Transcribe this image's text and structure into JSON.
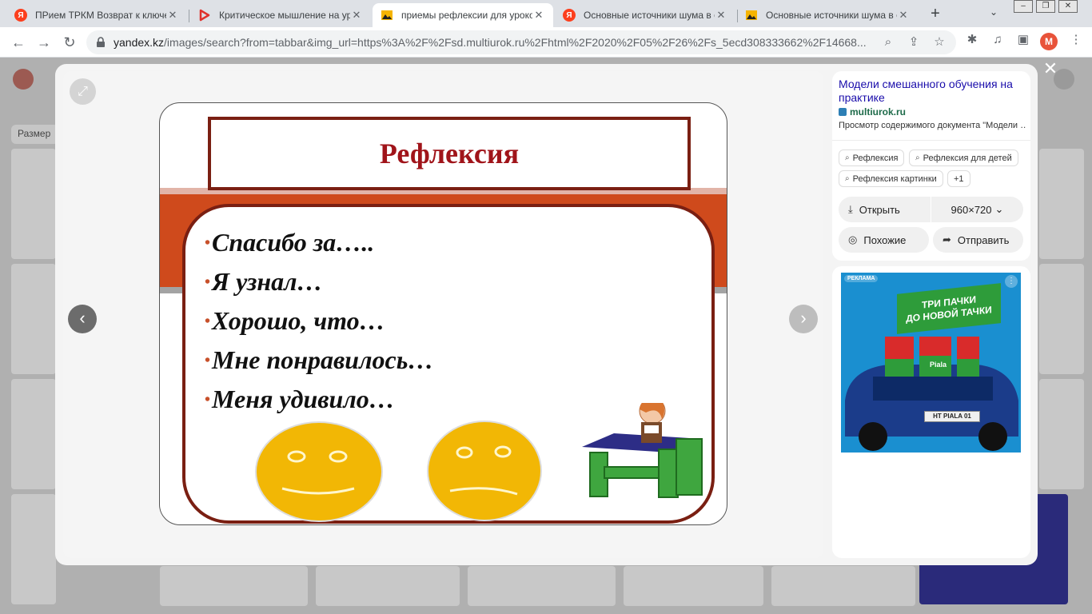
{
  "browser": {
    "tabs": [
      {
        "title": "ПРием ТРКМ Возврат к ключевым",
        "icon": "yandex-icon"
      },
      {
        "title": "Критическое мышление на уроке",
        "icon": "play-icon"
      },
      {
        "title": "приемы рефлексии для уроков с",
        "icon": "image-icon"
      },
      {
        "title": "Основные источники шума в окр",
        "icon": "yandex-icon"
      },
      {
        "title": "Основные источники шума в окр",
        "icon": "image-icon"
      }
    ],
    "url_domain": "yandex.kz",
    "url_rest": "/images/search?from=tabbar&img_url=https%3A%2F%2Fsd.multiurok.ru%2Fhtml%2F2020%2F05%2F26%2Fs_5ecd308333662%2F14668...",
    "profile_initial": "M"
  },
  "background": {
    "filter_label": "Размер"
  },
  "slide": {
    "title": "Рефлексия",
    "phrases": [
      "Спасибо за…..",
      "Я узнал…",
      "Хорошо, что…",
      "Мне понравилось…",
      "Меня удивило…"
    ]
  },
  "info": {
    "title": "Модели смешанного обучения на практике",
    "source": "multiurok.ru",
    "preview": "Просмотр содержимого документа \"Модели …",
    "tags": [
      "Рефлексия",
      "Рефлексия для детей",
      "Рефлексия картинки",
      "+1"
    ],
    "open_label": "Открыть",
    "size_label": "960×720",
    "similar_label": "Похожие",
    "share_label": "Отправить"
  },
  "ad": {
    "label": "РЕКЛАМА",
    "slogan_line1": "ТРИ ПАЧКИ",
    "slogan_line2": "ДО НОВОЙ ТАЧКИ",
    "brand": "Piala",
    "plate": "HT PIALA 01"
  },
  "colors": {
    "accent_link": "#1a0dab",
    "slide_title": "#a0141a",
    "slide_band": "#cf4a1c",
    "smiley": "#f2b705"
  }
}
